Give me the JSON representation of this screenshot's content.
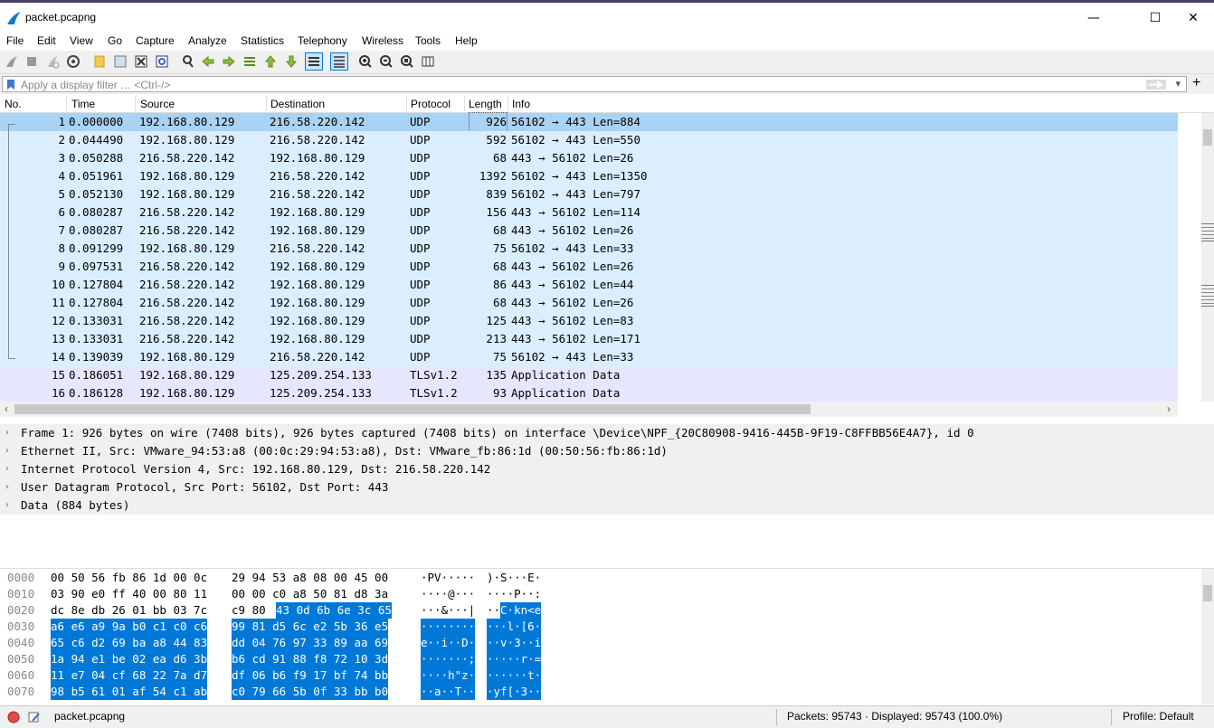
{
  "window": {
    "title": "packet.pcapng",
    "min_glyph": "—",
    "max_glyph": "☐",
    "close_glyph": "✕"
  },
  "menu": [
    "File",
    "Edit",
    "View",
    "Go",
    "Capture",
    "Analyze",
    "Statistics",
    "Telephony",
    "Wireless",
    "Tools",
    "Help"
  ],
  "filter": {
    "placeholder": "Apply a display filter … <Ctrl-/>",
    "plus": "+",
    "dropdown": "▾"
  },
  "columns": [
    "No.",
    "Time",
    "Source",
    "Destination",
    "Protocol",
    "Length",
    "Info"
  ],
  "packets": [
    {
      "no": "1",
      "time": "0.000000",
      "src": "192.168.80.129",
      "dst": "216.58.220.142",
      "proto": "UDP",
      "len": "926",
      "info": "56102 → 443 Len=884",
      "kind": "selected"
    },
    {
      "no": "2",
      "time": "0.044490",
      "src": "192.168.80.129",
      "dst": "216.58.220.142",
      "proto": "UDP",
      "len": "592",
      "info": "56102 → 443 Len=550",
      "kind": "udp"
    },
    {
      "no": "3",
      "time": "0.050288",
      "src": "216.58.220.142",
      "dst": "192.168.80.129",
      "proto": "UDP",
      "len": "68",
      "info": "443 → 56102 Len=26",
      "kind": "udp"
    },
    {
      "no": "4",
      "time": "0.051961",
      "src": "192.168.80.129",
      "dst": "216.58.220.142",
      "proto": "UDP",
      "len": "1392",
      "info": "56102 → 443 Len=1350",
      "kind": "udp"
    },
    {
      "no": "5",
      "time": "0.052130",
      "src": "192.168.80.129",
      "dst": "216.58.220.142",
      "proto": "UDP",
      "len": "839",
      "info": "56102 → 443 Len=797",
      "kind": "udp"
    },
    {
      "no": "6",
      "time": "0.080287",
      "src": "216.58.220.142",
      "dst": "192.168.80.129",
      "proto": "UDP",
      "len": "156",
      "info": "443 → 56102 Len=114",
      "kind": "udp"
    },
    {
      "no": "7",
      "time": "0.080287",
      "src": "216.58.220.142",
      "dst": "192.168.80.129",
      "proto": "UDP",
      "len": "68",
      "info": "443 → 56102 Len=26",
      "kind": "udp"
    },
    {
      "no": "8",
      "time": "0.091299",
      "src": "192.168.80.129",
      "dst": "216.58.220.142",
      "proto": "UDP",
      "len": "75",
      "info": "56102 → 443 Len=33",
      "kind": "udp"
    },
    {
      "no": "9",
      "time": "0.097531",
      "src": "216.58.220.142",
      "dst": "192.168.80.129",
      "proto": "UDP",
      "len": "68",
      "info": "443 → 56102 Len=26",
      "kind": "udp"
    },
    {
      "no": "10",
      "time": "0.127804",
      "src": "216.58.220.142",
      "dst": "192.168.80.129",
      "proto": "UDP",
      "len": "86",
      "info": "443 → 56102 Len=44",
      "kind": "udp"
    },
    {
      "no": "11",
      "time": "0.127804",
      "src": "216.58.220.142",
      "dst": "192.168.80.129",
      "proto": "UDP",
      "len": "68",
      "info": "443 → 56102 Len=26",
      "kind": "udp"
    },
    {
      "no": "12",
      "time": "0.133031",
      "src": "216.58.220.142",
      "dst": "192.168.80.129",
      "proto": "UDP",
      "len": "125",
      "info": "443 → 56102 Len=83",
      "kind": "udp"
    },
    {
      "no": "13",
      "time": "0.133031",
      "src": "216.58.220.142",
      "dst": "192.168.80.129",
      "proto": "UDP",
      "len": "213",
      "info": "443 → 56102 Len=171",
      "kind": "udp"
    },
    {
      "no": "14",
      "time": "0.139039",
      "src": "192.168.80.129",
      "dst": "216.58.220.142",
      "proto": "UDP",
      "len": "75",
      "info": "56102 → 443 Len=33",
      "kind": "udp"
    },
    {
      "no": "15",
      "time": "0.186051",
      "src": "192.168.80.129",
      "dst": "125.209.254.133",
      "proto": "TLSv1.2",
      "len": "135",
      "info": "Application Data",
      "kind": "tls"
    },
    {
      "no": "16",
      "time": "0.186128",
      "src": "192.168.80.129",
      "dst": "125.209.254.133",
      "proto": "TLSv1.2",
      "len": "93",
      "info": "Application Data",
      "kind": "tls"
    }
  ],
  "details": [
    "Frame 1: 926 bytes on wire (7408 bits), 926 bytes captured (7408 bits) on interface \\Device\\NPF_{20C80908-9416-445B-9F19-C8FFBB56E4A7}, id 0",
    "Ethernet II, Src: VMware_94:53:a8 (00:0c:29:94:53:a8), Dst: VMware_fb:86:1d (00:50:56:fb:86:1d)",
    "Internet Protocol Version 4, Src: 192.168.80.129, Dst: 216.58.220.142",
    "User Datagram Protocol, Src Port: 56102, Dst Port: 443",
    "Data (884 bytes)"
  ],
  "bytes": [
    {
      "off": "0000",
      "h1": "00 50 56 fb 86 1d 00 0c",
      "h2": "29 94 53 a8 08 00 45 00",
      "a1": "·PV·····",
      "a2": ")·S···E·",
      "sel": "none"
    },
    {
      "off": "0010",
      "h1": "03 90 e0 ff 40 00 80 11",
      "h2": "00 00 c0 a8 50 81 d8 3a",
      "a1": "····@···",
      "a2": "····P··:",
      "sel": "none"
    },
    {
      "off": "0020",
      "h1": "dc 8e db 26 01 bb 03 7c",
      "h2": "c9 80",
      "h2s": "43 0d 6b 6e 3c 65",
      "a1": "···&···|",
      "a2": "··",
      "a2s": "C·kn<e",
      "sel": "partial"
    },
    {
      "off": "0030",
      "h1": "a6 e6 a9 9a b0 c1 c0 c6",
      "h2": "99 81 d5 6c e2 5b 36 e5",
      "a1": "········",
      "a2": "···l·[6·",
      "sel": "full"
    },
    {
      "off": "0040",
      "h1": "65 c6 d2 69 ba a8 44 83",
      "h2": "dd 04 76 97 33 89 aa 69",
      "a1": "e··i··D·",
      "a2": "··v·3··i",
      "sel": "full"
    },
    {
      "off": "0050",
      "h1": "1a 94 e1 be 02 ea d6 3b",
      "h2": "b6 cd 91 88 f8 72 10 3d",
      "a1": "·······;",
      "a2": "·····r·=",
      "sel": "full"
    },
    {
      "off": "0060",
      "h1": "11 e7 04 cf 68 22 7a d7",
      "h2": "df 06 b6 f9 17 bf 74 bb",
      "a1": "····h\"z·",
      "a2": "······t·",
      "sel": "full"
    },
    {
      "off": "0070",
      "h1": "98 b5 61 01 af 54 c1 ab",
      "h2": "c0 79 66 5b 0f 33 bb b0",
      "a1": "··a··T··",
      "a2": "·yf[·3··",
      "sel": "full"
    }
  ],
  "status": {
    "file": "packet.pcapng",
    "packets": "Packets: 95743 · Displayed: 95743 (100.0%)",
    "profile": "Profile: Default"
  },
  "colors": {
    "selected": "#a9d3f5",
    "udp": "#daeeff",
    "tls": "#e7e6ff",
    "byte_sel": "#0078d7"
  }
}
